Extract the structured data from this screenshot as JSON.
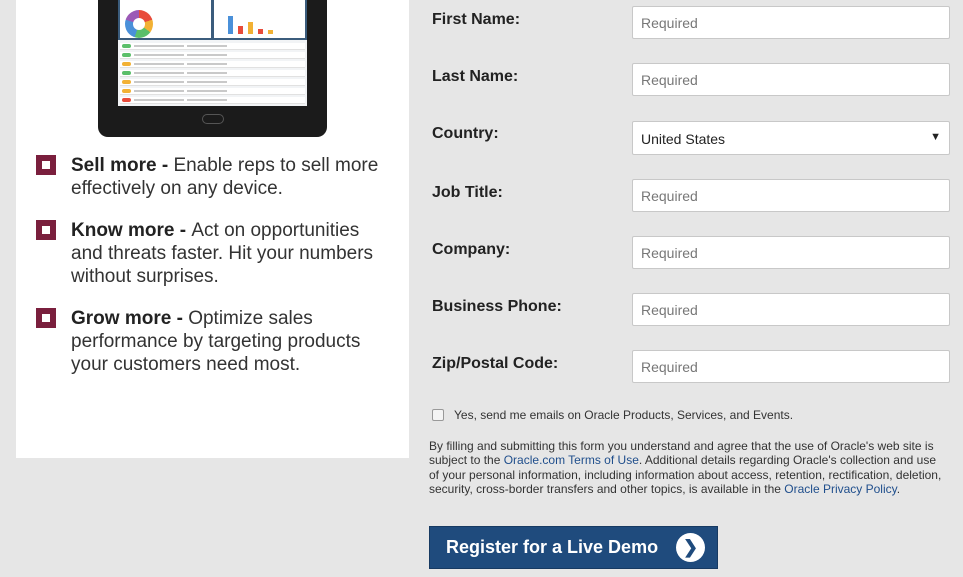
{
  "promo": {
    "bullets": [
      {
        "title": "Sell more",
        "sep": " - ",
        "text": "Enable reps to sell more effectively on any device."
      },
      {
        "title": "Know more",
        "sep": " - ",
        "text": "Act on opportunities and threats faster. Hit your numbers without surprises."
      },
      {
        "title": "Grow more",
        "sep": " - ",
        "text": "Optimize sales performance by targeting products your customers need most."
      }
    ]
  },
  "form": {
    "first_name": {
      "label": "First Name:",
      "placeholder": "Required"
    },
    "last_name": {
      "label": "Last Name:",
      "placeholder": "Required"
    },
    "country": {
      "label": "Country:",
      "value": "United States"
    },
    "job_title": {
      "label": "Job Title:",
      "placeholder": "Required"
    },
    "company": {
      "label": "Company:",
      "placeholder": "Required"
    },
    "business_phone": {
      "label": "Business Phone:",
      "placeholder": "Required"
    },
    "zip": {
      "label": "Zip/Postal Code:",
      "placeholder": "Required"
    },
    "optin_label": "Yes, send me emails on Oracle Products, Services, and Events.",
    "legal": {
      "part1": "By filling and submitting this form you understand and agree that the use of Oracle's web site is subject to the ",
      "terms_link": "Oracle.com Terms of Use",
      "part2": ". Additional details regarding Oracle's collection and use of your personal information, including information about access, retention, rectification, deletion, security, cross-border transfers and other topics, is available in the ",
      "privacy_link": "Oracle Privacy Policy",
      "part3": "."
    },
    "submit_label": "Register for a Live Demo",
    "submit_icon": "❯"
  }
}
